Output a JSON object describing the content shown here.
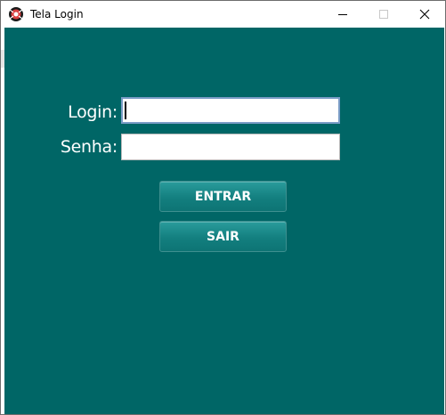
{
  "window": {
    "title": "Tela Login",
    "icon": "app-logo-icon",
    "controls": [
      "minimize-icon",
      "maximize-icon",
      "close-icon"
    ]
  },
  "form": {
    "login_label": "Login:",
    "login_value": "",
    "senha_label": "Senha:",
    "senha_value": ""
  },
  "buttons": {
    "entrar_label": "ENTRAR",
    "sair_label": "SAIR"
  },
  "colors": {
    "background": "#006666",
    "button": "#137f7f",
    "focus_border": "#7a9cc6"
  }
}
